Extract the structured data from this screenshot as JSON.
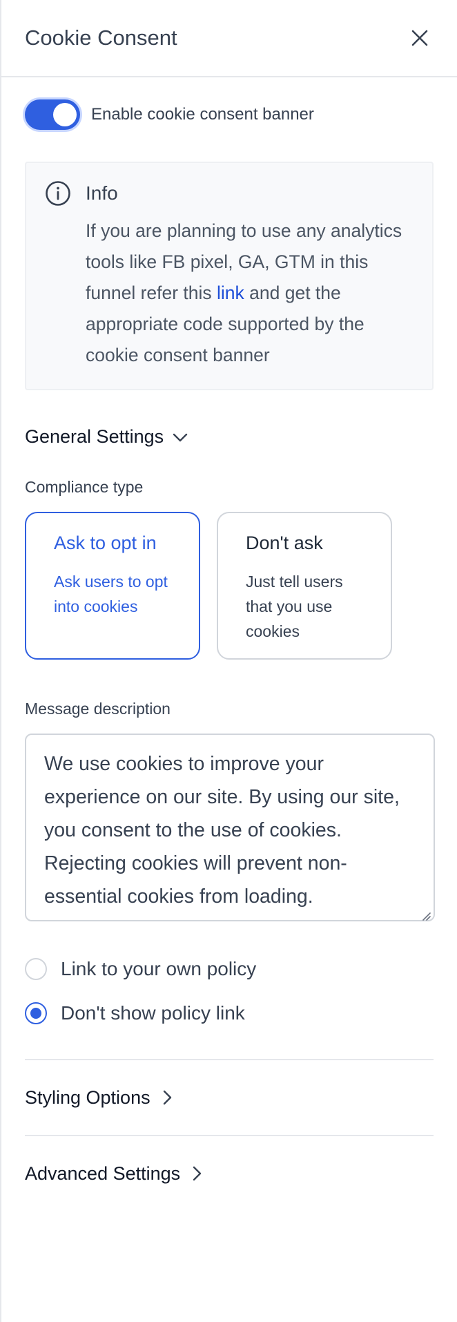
{
  "header": {
    "title": "Cookie Consent"
  },
  "toggle": {
    "label": "Enable cookie consent banner",
    "enabled": true
  },
  "info": {
    "title": "Info",
    "text_before": "If you are planning to use any analytics tools like FB pixel, GA, GTM in this funnel refer this ",
    "link_text": "link",
    "text_after": " and get the appropriate code supported by the cookie consent banner"
  },
  "general": {
    "heading": "General Settings",
    "compliance_label": "Compliance type",
    "options": [
      {
        "title": "Ask to opt in",
        "desc": "Ask users to opt into cookies",
        "selected": true
      },
      {
        "title": "Don't ask",
        "desc": "Just tell users that you use cookies",
        "selected": false
      }
    ],
    "message_label": "Message description",
    "message_value": "We use cookies to improve your experience on our site. By using our site, you consent to the use of cookies. Rejecting cookies will prevent non-essential cookies from loading.",
    "policy_options": [
      {
        "label": "Link to your own policy",
        "checked": false
      },
      {
        "label": "Don't show policy link",
        "checked": true
      }
    ]
  },
  "sections": {
    "styling": "Styling Options",
    "advanced": "Advanced Settings"
  },
  "colors": {
    "accent": "#2f5fe0",
    "link": "#1d4ed8",
    "border": "#d1d5db",
    "info_bg": "#f8f9fb"
  }
}
